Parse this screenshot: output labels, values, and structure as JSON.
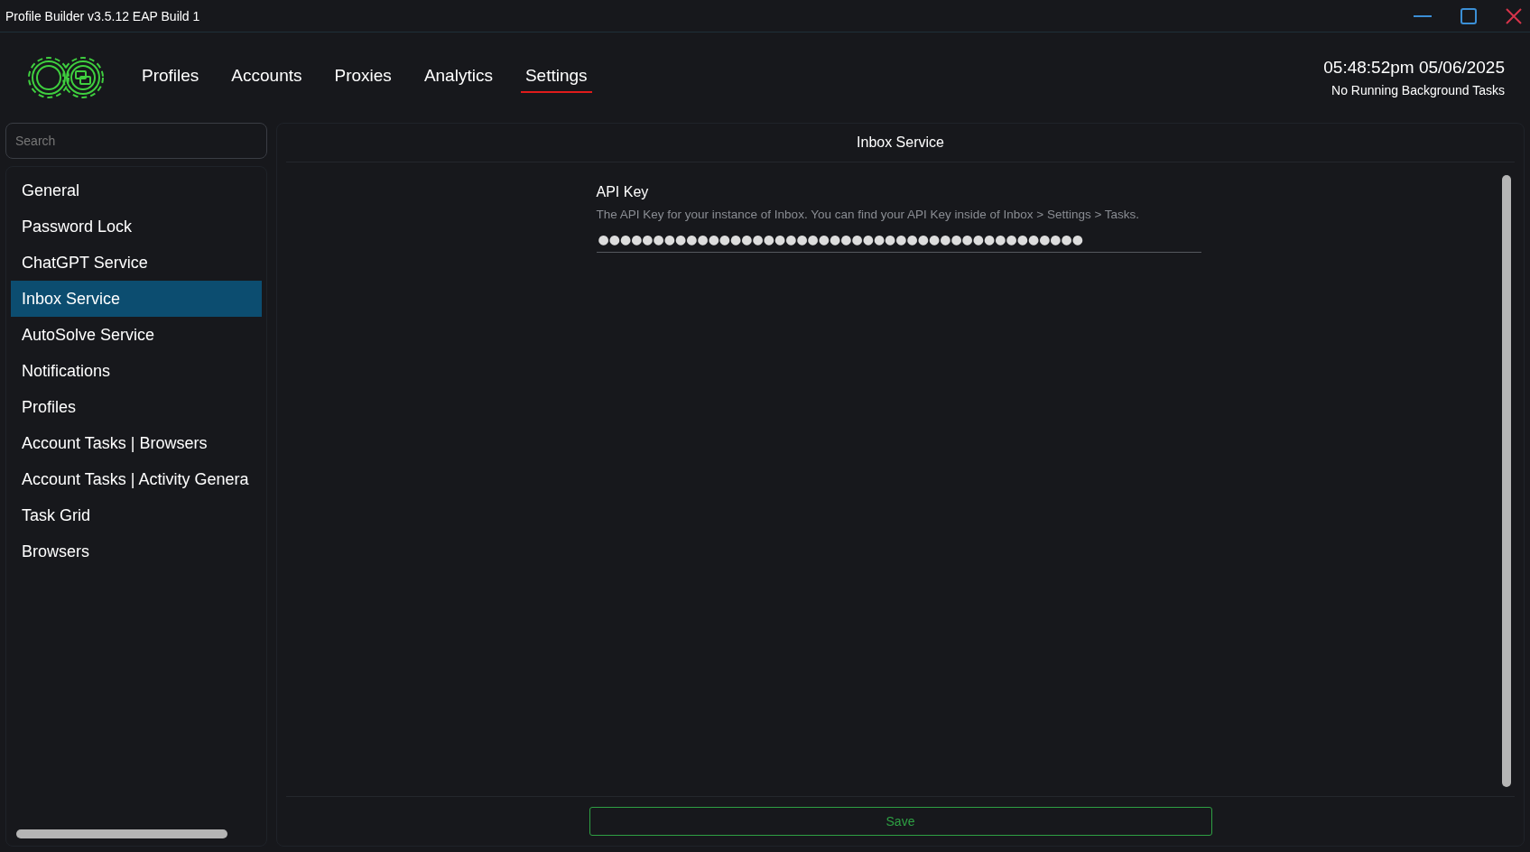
{
  "window": {
    "title": "Profile Builder v3.5.12 EAP Build 1"
  },
  "nav": [
    {
      "label": "Profiles",
      "selected": false
    },
    {
      "label": "Accounts",
      "selected": false
    },
    {
      "label": "Proxies",
      "selected": false
    },
    {
      "label": "Analytics",
      "selected": false
    },
    {
      "label": "Settings",
      "selected": true
    }
  ],
  "status": {
    "datetime": "05:48:52pm 05/06/2025",
    "tasks": "No Running Background Tasks"
  },
  "sidebar": {
    "search": {
      "placeholder": "Search"
    },
    "items": [
      {
        "label": "General",
        "selected": false
      },
      {
        "label": "Password Lock",
        "selected": false
      },
      {
        "label": "ChatGPT Service",
        "selected": false
      },
      {
        "label": "Inbox Service",
        "selected": true
      },
      {
        "label": "AutoSolve Service",
        "selected": false
      },
      {
        "label": "Notifications",
        "selected": false
      },
      {
        "label": "Profiles",
        "selected": false
      },
      {
        "label": "Account Tasks | Browsers",
        "selected": false
      },
      {
        "label": "Account Tasks | Activity Genera",
        "selected": false
      },
      {
        "label": "Task Grid",
        "selected": false
      },
      {
        "label": "Browsers",
        "selected": false
      }
    ]
  },
  "panel": {
    "title": "Inbox Service",
    "fields": [
      {
        "label": "API Key",
        "description": "The API Key for your instance of Inbox. You can find your API Key inside of Inbox > Settings > Tasks.",
        "value": "●●●●●●●●●●●●●●●●●●●●●●●●●●●●●●●●●●●●●●●●●●●●"
      }
    ],
    "save": "Save"
  }
}
